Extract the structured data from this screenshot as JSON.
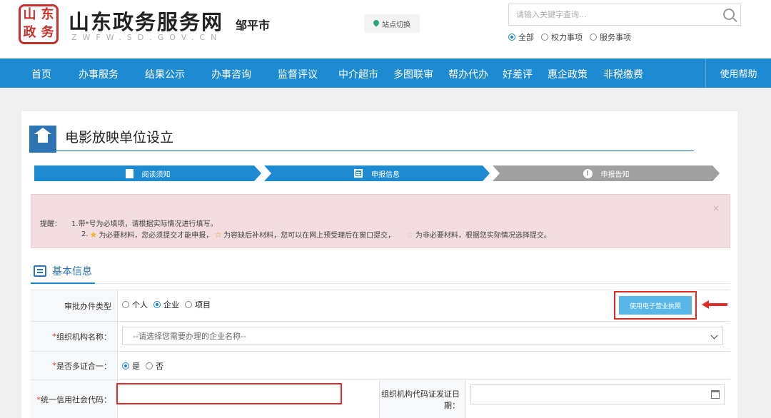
{
  "header": {
    "logo_chars": [
      "山",
      "东",
      "政",
      "务"
    ],
    "site_name": "山东政务服务网",
    "site_domain": "ZWFW.SD.GOV.CN",
    "city": "邹平市",
    "site_switch": "站点切换",
    "search": {
      "placeholder": "请输入关键字查询..."
    },
    "scope": {
      "options": [
        "全部",
        "权力事项",
        "服务事项"
      ],
      "selected": "全部"
    }
  },
  "nav": {
    "items": [
      "首页",
      "办事服务",
      "结果公示",
      "办事咨询",
      "监督评议",
      "中介超市",
      "多图联审",
      "帮办代办",
      "好差评",
      "惠企政策",
      "非税缴费"
    ],
    "help": "使用帮助"
  },
  "page": {
    "title": "电影放映单位设立",
    "steps": [
      "阅读须知",
      "申报信息",
      "申报告知"
    ]
  },
  "notice": {
    "label": "提醒：",
    "line1": "1.带*号为必填项，请根据实际情况进行填写。",
    "line2_prefix": "2.",
    "line2_part1": "为必要材料，您必须提交才能申报，",
    "line2_part2": "为容缺后补材料，您可以在网上预受理后在窗口提交，",
    "line2_part3": "为非必要材料，根据您实际情况选择提交。",
    "close": "×",
    "colors": {
      "required_star": "#f2b51c",
      "deferred_star": "#e9a23b",
      "optional_star": "#cccccc"
    }
  },
  "section": {
    "title": "基本信息"
  },
  "form": {
    "approval_type": {
      "label": "审批办件类型",
      "options": [
        "个人",
        "企业",
        "项目"
      ],
      "selected": "企业"
    },
    "ebiz_button": "使用电子营业执照",
    "org_name": {
      "required_mark": "*",
      "label": "组织机构名称：",
      "placeholder": "--请选择您需要办理的企业名称--"
    },
    "multi_cert": {
      "required_mark": "*",
      "label": "是否多证合一：",
      "options": [
        "是",
        "否"
      ],
      "selected": "是"
    },
    "credit_code": {
      "required_mark": "*",
      "label": "统一信用社会代码：",
      "value": ""
    },
    "org_code_date": {
      "label": "组织机构代码证发证日期："
    }
  },
  "colors": {
    "nav_bg": "#1e8ad1",
    "step_active": "#1e8ad1",
    "step_inactive": "#a0a0a0",
    "highlight_red": "#e02b27",
    "notice_bg": "#f3dde0"
  }
}
